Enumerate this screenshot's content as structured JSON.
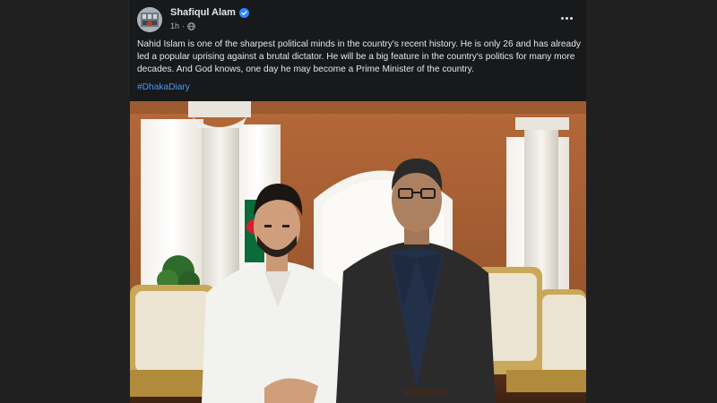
{
  "post": {
    "author": "Shafiqul Alam",
    "verified": true,
    "time": "1h",
    "audience_icon": "globe-icon",
    "menu_icon": "more-horizontal-icon",
    "text": "Nahid Islam is one of the sharpest political minds in the country's recent history. He is only 26 and has already led a popular uprising against a brutal dictator. He will be a big feature in the country's politics for many more decades. And God knows, one day he may become a Prime Minister of the country.",
    "hashtag": "#DhakaDiary",
    "photo_description_icon": "photo"
  },
  "colors": {
    "page_bg": "#202021",
    "card_bg": "#18191a",
    "text_primary": "#e4e6eb",
    "text_secondary": "#b0b3b8",
    "link": "#4599ff",
    "verified": "#2d88ff"
  }
}
